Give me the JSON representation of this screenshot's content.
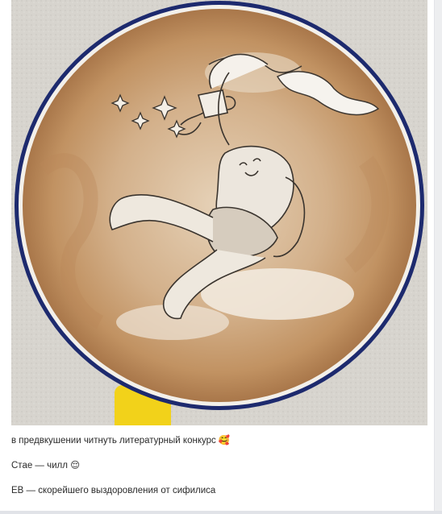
{
  "post": {
    "image_alt": "latte art illustration",
    "lines": [
      "в предвкушении читнуть литературный конкурс 🥰",
      "Стае — чилл 😌",
      "ЕВ — скорейшего выздоровления от сифилиса"
    ]
  },
  "colors": {
    "page_background": "#edeef0",
    "card_background": "#ffffff",
    "cup_rim": "#1d2a6e",
    "cup_handle": "#f2d21a",
    "foam": "#c9a27a"
  }
}
